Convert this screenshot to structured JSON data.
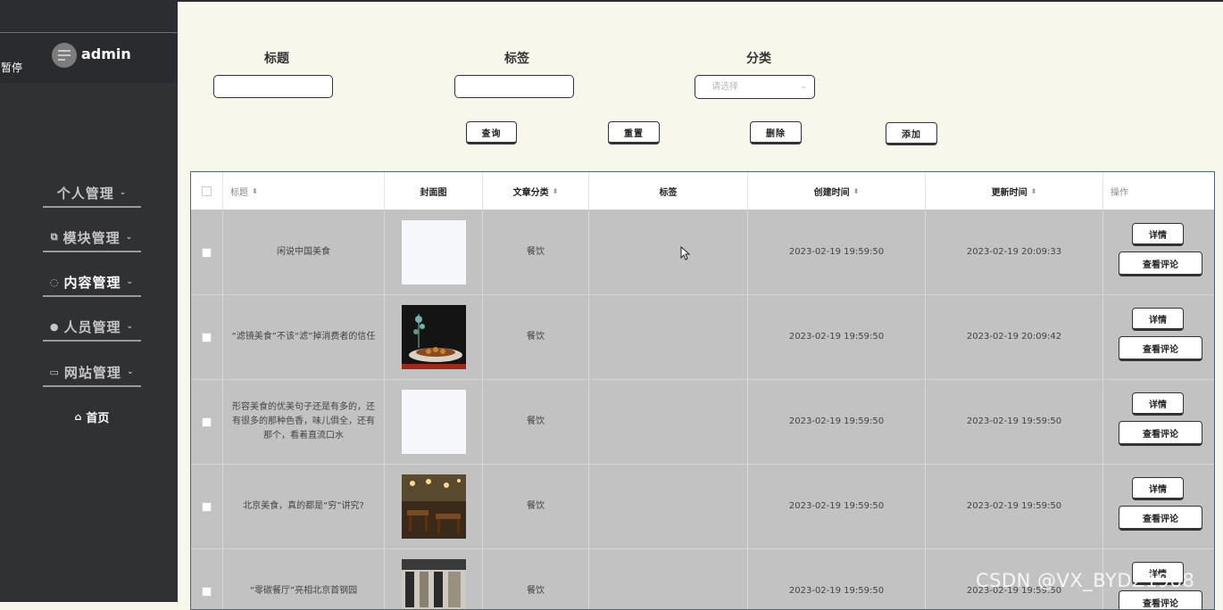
{
  "sidebar": {
    "username": "admin",
    "pause_label": "暂停",
    "menu": [
      {
        "label": "个人管理",
        "icon": "none",
        "active": false
      },
      {
        "label": "模块管理",
        "icon": "copy-icon",
        "active": false
      },
      {
        "label": "内容管理",
        "icon": "comment-icon",
        "active": true
      },
      {
        "label": "人员管理",
        "icon": "user-icon",
        "active": false
      },
      {
        "label": "网站管理",
        "icon": "monitor-icon",
        "active": false
      }
    ],
    "home_label": "首页"
  },
  "filters": {
    "title_label": "标题",
    "tag_label": "标签",
    "category_label": "分类",
    "category_placeholder": "请选择",
    "title_value": "",
    "tag_value": ""
  },
  "actions": {
    "query": "查询",
    "reset": "重置",
    "delete": "删除",
    "add": "添加"
  },
  "table": {
    "headers": {
      "title": "标题",
      "cover": "封面图",
      "category": "文章分类",
      "tags": "标签",
      "created": "创建时间",
      "updated": "更新时间",
      "ops": "操作"
    },
    "rows": [
      {
        "title": "闲说中国美食",
        "category": "餐饮",
        "tags": "",
        "created": "2023-02-19 19:59:50",
        "updated": "2023-02-19 20:09:33",
        "cover": "blank"
      },
      {
        "title": "“滤镜美食”不该“滤”掉消费者的信任",
        "category": "餐饮",
        "tags": "",
        "created": "2023-02-19 19:59:50",
        "updated": "2023-02-19 20:09:42",
        "cover": "food-dish"
      },
      {
        "title": "形容美食的优美句子还是有多的，还有很多的那种色香，味儿俱全，还有那个，看着直流口水",
        "category": "餐饮",
        "tags": "",
        "created": "2023-02-19 19:59:50",
        "updated": "2023-02-19 19:59:50",
        "cover": "blank"
      },
      {
        "title": "北京美食，真的都是“穷”讲究?",
        "category": "餐饮",
        "tags": "",
        "created": "2023-02-19 19:59:50",
        "updated": "2023-02-19 19:59:50",
        "cover": "restaurant-warm"
      },
      {
        "title": "“零碳餐厅”亮相北京首钢园",
        "category": "餐饮",
        "tags": "",
        "created": "2023-02-19 19:59:50",
        "updated": "2023-02-19 19:59:50",
        "cover": "restaurant-interior"
      }
    ],
    "detail_label": "详情",
    "comments_label": "查看评论"
  },
  "watermark": "CSDN @VX_BYDZ1988"
}
